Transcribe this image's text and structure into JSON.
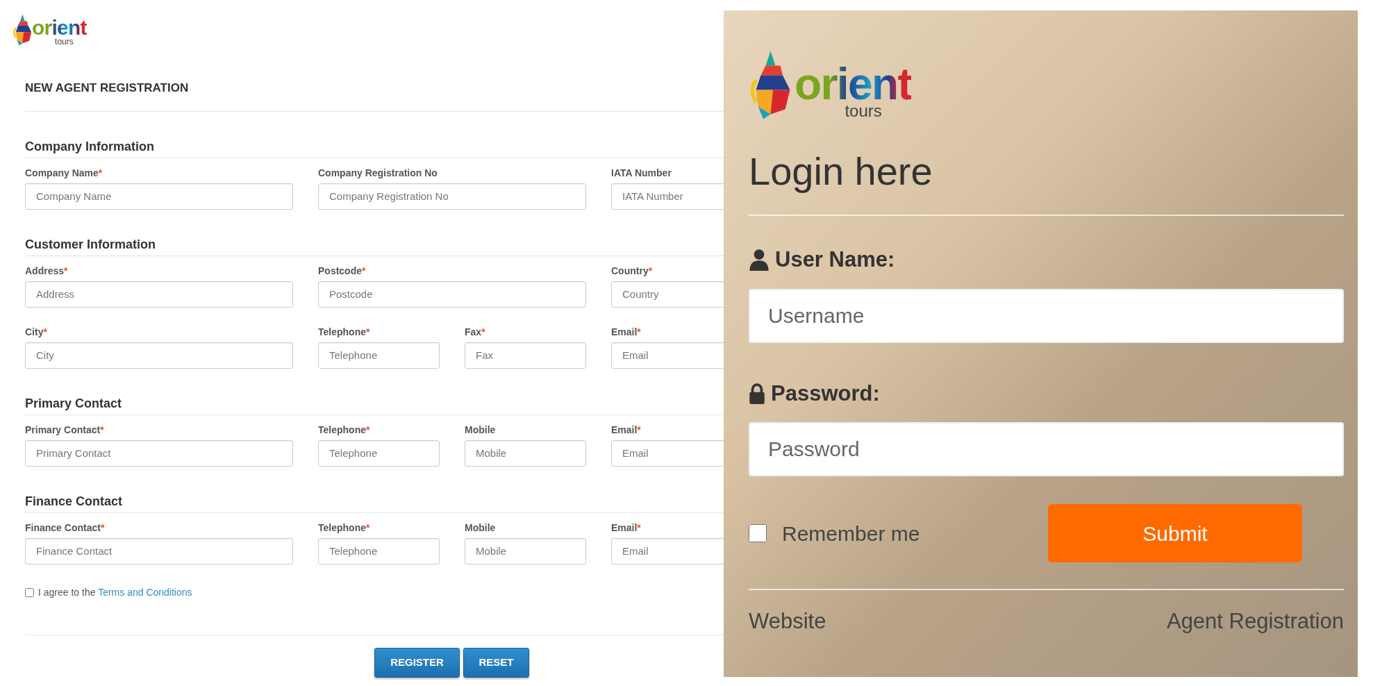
{
  "registration": {
    "logo": {
      "word": "orient",
      "sub": "tours"
    },
    "title": "NEW AGENT REGISTRATION",
    "sections": [
      {
        "heading": "Company Information",
        "rows": [
          [
            {
              "kind": "wide",
              "label": "Company Name",
              "required_mark": "*",
              "placeholder": "Company Name"
            },
            {
              "kind": "wide",
              "label": "Company Registration No",
              "placeholder": "Company Registration No"
            },
            {
              "kind": "wide",
              "label": "IATA Number",
              "placeholder": "IATA Number"
            }
          ]
        ]
      },
      {
        "heading": "Customer Information",
        "rows": [
          [
            {
              "kind": "wide",
              "label": "Address",
              "required_mark": "*",
              "placeholder": "Address"
            },
            {
              "kind": "wide",
              "label": "Postcode",
              "required_mark": "*",
              "placeholder": "Postcode"
            },
            {
              "kind": "wide",
              "label": "Country",
              "required_mark": "*",
              "placeholder": "Country"
            }
          ],
          [
            {
              "kind": "wide",
              "label": "City",
              "required_mark": "*",
              "placeholder": "City"
            },
            {
              "kind": "pair",
              "fields": [
                {
                  "label": "Telephone",
                  "required_mark": "*",
                  "placeholder": "Telephone"
                },
                {
                  "label": "Fax",
                  "required_mark": "*",
                  "placeholder": "Fax"
                }
              ]
            },
            {
              "kind": "wide",
              "label": "Email",
              "required_mark": "*",
              "placeholder": "Email"
            }
          ]
        ]
      },
      {
        "heading": "Primary Contact",
        "rows": [
          [
            {
              "kind": "wide",
              "label": "Primary Contact",
              "required_mark": "*",
              "placeholder": "Primary Contact"
            },
            {
              "kind": "pair",
              "fields": [
                {
                  "label": "Telephone",
                  "required_mark": "*",
                  "placeholder": "Telephone"
                },
                {
                  "label": "Mobile",
                  "placeholder": "Mobile"
                }
              ]
            },
            {
              "kind": "wide",
              "label": "Email",
              "required_mark": "*",
              "placeholder": "Email"
            }
          ]
        ]
      },
      {
        "heading": "Finance Contact",
        "rows": [
          [
            {
              "kind": "wide",
              "label": "Finance Contact",
              "required_mark": "*",
              "placeholder": "Finance Contact"
            },
            {
              "kind": "pair",
              "fields": [
                {
                  "label": "Telephone",
                  "required_mark": "*",
                  "placeholder": "Telephone"
                },
                {
                  "label": "Mobile",
                  "placeholder": "Mobile"
                }
              ]
            },
            {
              "kind": "wide",
              "label": "Email",
              "required_mark": "*",
              "placeholder": "Email"
            }
          ]
        ]
      }
    ],
    "terms": {
      "checked": false,
      "text": "I agree to the",
      "link": "Terms and Conditions"
    },
    "buttons": [
      "REGISTER",
      "RESET"
    ]
  },
  "login": {
    "logo": {
      "word": "orient",
      "sub": "tours"
    },
    "title": "Login here",
    "fields": [
      {
        "kind": "user",
        "label": "User Name:",
        "placeholder": "Username"
      },
      {
        "kind": "password",
        "label": "Password:",
        "placeholder": "Password"
      }
    ],
    "remember": {
      "label": "Remember me",
      "checked": false
    },
    "submit": "Submit",
    "links": [
      "Website",
      "Agent Registration"
    ]
  }
}
